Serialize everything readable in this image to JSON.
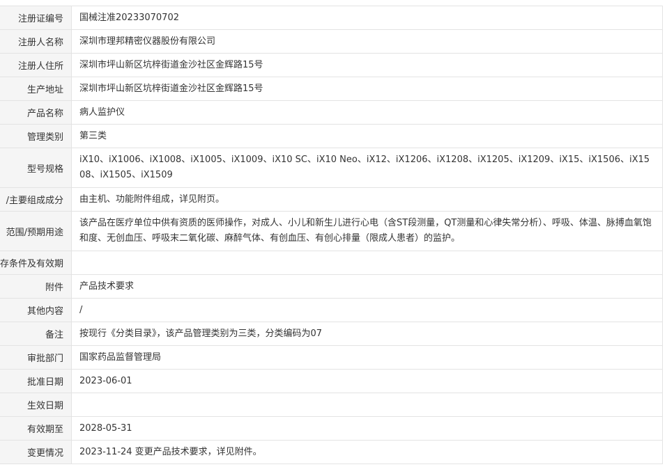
{
  "rows": [
    {
      "label": "注册证编号",
      "value": "国械注准20233070702"
    },
    {
      "label": "注册人名称",
      "value": "深圳市理邦精密仪器股份有限公司"
    },
    {
      "label": "注册人住所",
      "value": "深圳市坪山新区坑梓街道金沙社区金辉路15号"
    },
    {
      "label": "生产地址",
      "value": "深圳市坪山新区坑梓街道金沙社区金辉路15号"
    },
    {
      "label": "产品名称",
      "value": "病人监护仪"
    },
    {
      "label": "管理类别",
      "value": "第三类"
    },
    {
      "label": "型号规格",
      "value": "iX10、iX1006、iX1008、iX1005、iX1009、iX10 SC、iX10 Neo、iX12、iX1206、iX1208、iX1205、iX1209、iX15、iX1506、iX1508、iX1505、iX1509"
    },
    {
      "label": "/主要组成成分",
      "value": "由主机、功能附件组成，详见附页。"
    },
    {
      "label": "范围/预期用途",
      "value": "该产品在医疗单位中供有资质的医师操作，对成人、小儿和新生儿进行心电（含ST段测量，QT测量和心律失常分析）、呼吸、体温、脉搏血氧饱和度、无创血压、呼吸末二氧化碳、麻醉气体、有创血压、有创心排量（限成人患者）的监护。"
    },
    {
      "label": "存条件及有效期",
      "value": ""
    },
    {
      "label": "附件",
      "value": "产品技术要求"
    },
    {
      "label": "其他内容",
      "value": "/"
    },
    {
      "label": "备注",
      "value": "按现行《分类目录》，该产品管理类别为三类，分类编码为07"
    },
    {
      "label": "审批部门",
      "value": "国家药品监督管理局"
    },
    {
      "label": "批准日期",
      "value": "2023-06-01"
    },
    {
      "label": "生效日期",
      "value": ""
    },
    {
      "label": "有效期至",
      "value": "2028-05-31"
    },
    {
      "label": "变更情况",
      "value": "2023-11-24 变更产品技术要求，详见附件。"
    }
  ]
}
